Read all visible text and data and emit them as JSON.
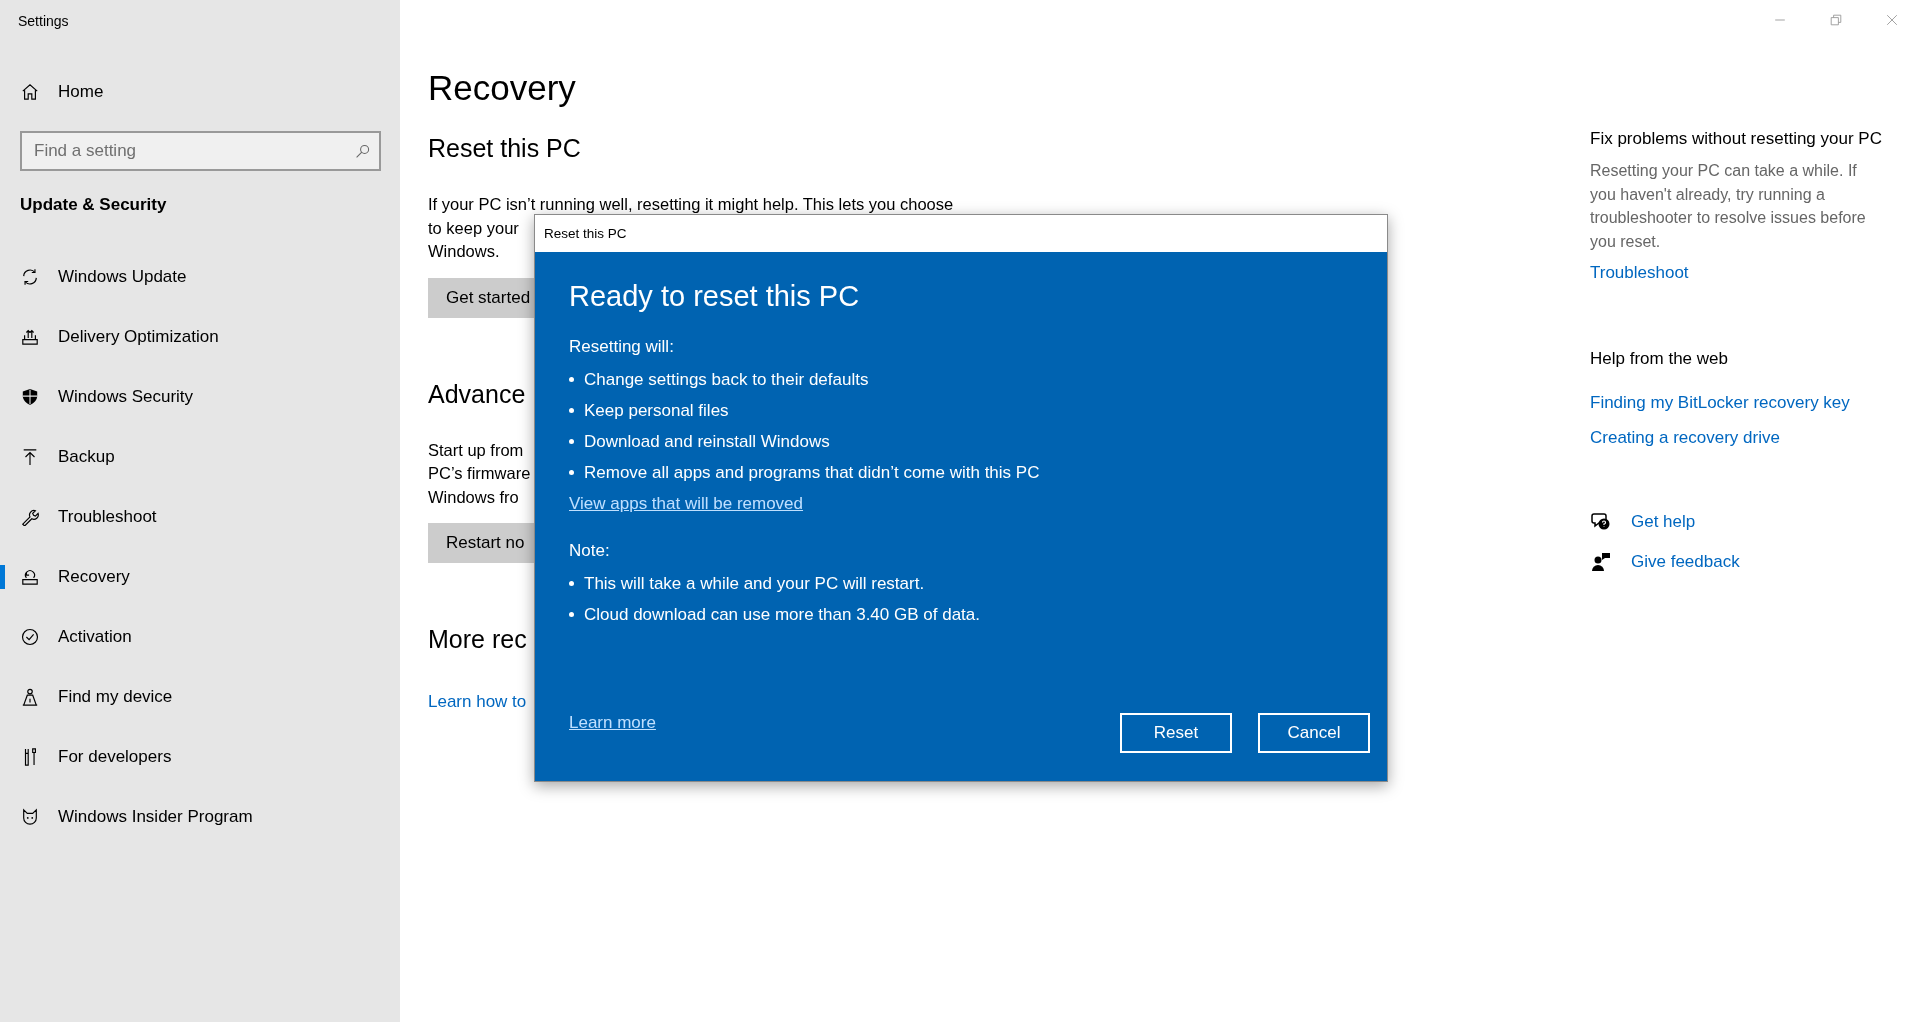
{
  "window": {
    "title": "Settings"
  },
  "sidebar": {
    "home": "Home",
    "search": {
      "placeholder": "Find a setting"
    },
    "section": "Update & Security",
    "items": [
      {
        "label": "Windows Update",
        "selected": false
      },
      {
        "label": "Delivery Optimization",
        "selected": false
      },
      {
        "label": "Windows Security",
        "selected": false
      },
      {
        "label": "Backup",
        "selected": false
      },
      {
        "label": "Troubleshoot",
        "selected": false
      },
      {
        "label": "Recovery",
        "selected": true
      },
      {
        "label": "Activation",
        "selected": false
      },
      {
        "label": "Find my device",
        "selected": false
      },
      {
        "label": "For developers",
        "selected": false
      },
      {
        "label": "Windows Insider Program",
        "selected": false
      }
    ]
  },
  "page": {
    "title": "Recovery",
    "sections": [
      {
        "heading": "Reset this PC",
        "lines": [
          "If your PC isn’t running well, resetting it might help. This lets you choose",
          "to keep your",
          "Windows."
        ],
        "button": "Get started"
      },
      {
        "heading": "Advance",
        "lines": [
          "Start up from",
          "PC’s firmware",
          "Windows fro"
        ],
        "button": "Restart no"
      },
      {
        "heading": "More rec",
        "link": "Learn how to"
      }
    ]
  },
  "related": {
    "fix": {
      "heading": "Fix problems without resetting your PC",
      "text": "Resetting your PC can take a while. If you haven't already, try running a troubleshooter to resolve issues before you reset.",
      "link": "Troubleshoot"
    },
    "web": {
      "heading": "Help from the web",
      "links": [
        "Finding my BitLocker recovery key",
        "Creating a recovery drive"
      ]
    },
    "support": [
      "Get help",
      "Give feedback"
    ]
  },
  "dialog": {
    "title": "Reset this PC",
    "heading": "Ready to reset this PC",
    "will_label": "Resetting will:",
    "will_items": [
      "Change settings back to their defaults",
      "Keep personal files",
      "Download and reinstall Windows",
      "Remove all apps and programs that didn’t come with this PC"
    ],
    "apps_link": "View apps that will be removed",
    "note_label": "Note:",
    "note_items": [
      "This will take a while and your PC will restart.",
      "Cloud download can use more than 3.40 GB of data."
    ],
    "learn_more": "Learn more",
    "buttons": [
      "Reset",
      "Cancel"
    ]
  }
}
